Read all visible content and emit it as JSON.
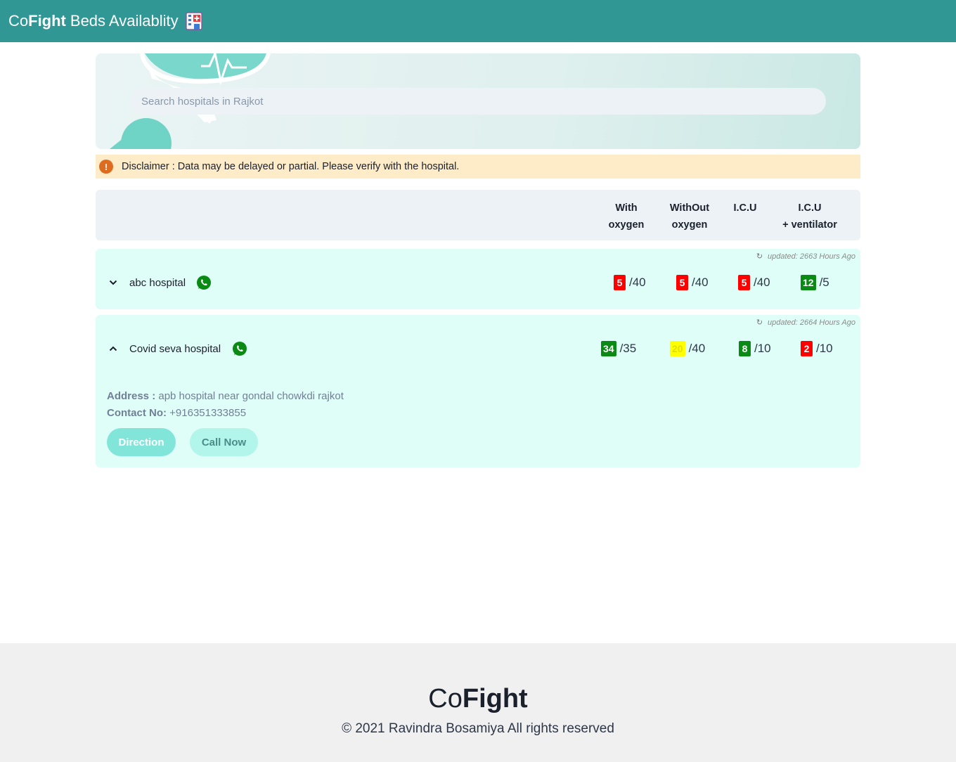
{
  "header": {
    "brand_co": "Co",
    "brand_fight": "Fight",
    "brand_rest": "Beds Availablity",
    "icon": "hospital-icon",
    "bg_color": "#319795"
  },
  "search": {
    "placeholder": "Search hospitals in Rajkot",
    "value": ""
  },
  "disclaimer": {
    "icon": "warning-icon",
    "text": "Disclaimer : Data may be delayed or partial. Please verify with the hospital."
  },
  "table": {
    "columns": [
      {
        "line1": "With",
        "line2": "oxygen"
      },
      {
        "line1": "WithOut",
        "line2": "oxygen"
      },
      {
        "line1": "I.C.U",
        "line2": ""
      },
      {
        "line1": "I.C.U",
        "line2": "+ ventilator"
      }
    ]
  },
  "hospitals": [
    {
      "name": "abc hospital",
      "updated": "updated: 2663 Hours Ago",
      "expanded": false,
      "chevron": "chevron-down-icon",
      "beds": [
        {
          "available": "5",
          "total": "/40",
          "status": "red"
        },
        {
          "available": "5",
          "total": "/40",
          "status": "red"
        },
        {
          "available": "5",
          "total": "/40",
          "status": "red"
        },
        {
          "available": "12",
          "total": "/5",
          "status": "green"
        }
      ]
    },
    {
      "name": "Covid seva hospital",
      "updated": "updated: 2664 Hours Ago",
      "expanded": true,
      "chevron": "chevron-up-icon",
      "beds": [
        {
          "available": "34",
          "total": "/35",
          "status": "green"
        },
        {
          "available": "20",
          "total": "/40",
          "status": "yellow"
        },
        {
          "available": "8",
          "total": "/10",
          "status": "green"
        },
        {
          "available": "2",
          "total": "/10",
          "status": "red"
        }
      ],
      "address_label": "Address :",
      "address": "apb hospital near gondal chowkdi rajkot",
      "contact_label": "Contact No:",
      "contact": "+916351333855",
      "direction_label": "Direction",
      "call_label": "Call Now"
    }
  ],
  "footer": {
    "logo_co": "Co",
    "logo_fight": "Fight",
    "copyright": "© 2021 Ravindra Bosamiya All rights reserved"
  }
}
